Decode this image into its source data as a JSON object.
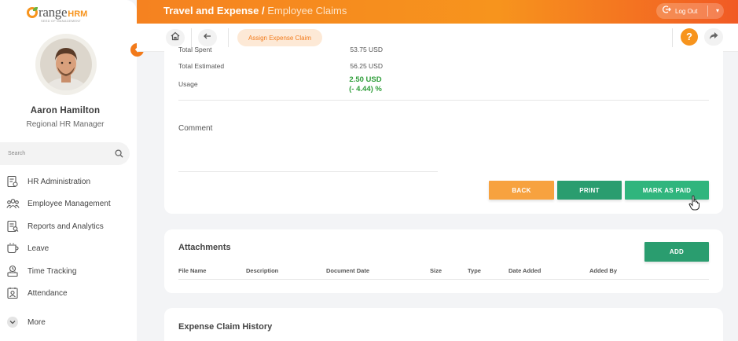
{
  "app": {
    "logo_word": "range",
    "logo_suffix": "HRM",
    "logo_tagline": "SEED OF MANAGEMENT"
  },
  "user": {
    "name": "Aaron Hamilton",
    "role": "Regional HR Manager"
  },
  "search": {
    "placeholder": "Search"
  },
  "sidebar": {
    "items": [
      {
        "label": "HR Administration",
        "icon": "hr-admin-icon"
      },
      {
        "label": "Employee Management",
        "icon": "people-icon"
      },
      {
        "label": "Reports and Analytics",
        "icon": "report-icon"
      },
      {
        "label": "Leave",
        "icon": "leave-icon"
      },
      {
        "label": "Time Tracking",
        "icon": "time-icon"
      },
      {
        "label": "Attendance",
        "icon": "attendance-icon"
      },
      {
        "label": "More",
        "icon": "chevron-down-icon"
      }
    ]
  },
  "header": {
    "title": "Travel and Expense /",
    "subtitle": " Employee Claims",
    "logout_label": "Log Out"
  },
  "toolbar": {
    "assign_label": "Assign Expense Claim",
    "help_label": "?"
  },
  "summary": {
    "total_spent_label": "Total Spent",
    "total_spent_value": "53.75 USD",
    "total_estimated_label": "Total Estimated",
    "total_estimated_value": "56.25 USD",
    "usage_label": "Usage",
    "usage_value": "2.50 USD",
    "usage_percent": "(- 4.44) %"
  },
  "comment": {
    "label": "Comment"
  },
  "actions": {
    "back_label": "BACK",
    "print_label": "PRINT",
    "mark_paid_label": "MARK AS PAID"
  },
  "attachments": {
    "title": "Attachments",
    "add_label": "ADD",
    "columns": [
      "File Name",
      "Description",
      "Document Date",
      "Size",
      "Type",
      "Date Added",
      "Added By"
    ]
  },
  "history": {
    "title": "Expense Claim History"
  },
  "colors": {
    "brand_orange": "#f7941d",
    "accent_green": "#2a9d6f",
    "usage_green": "#2f9e3a"
  }
}
